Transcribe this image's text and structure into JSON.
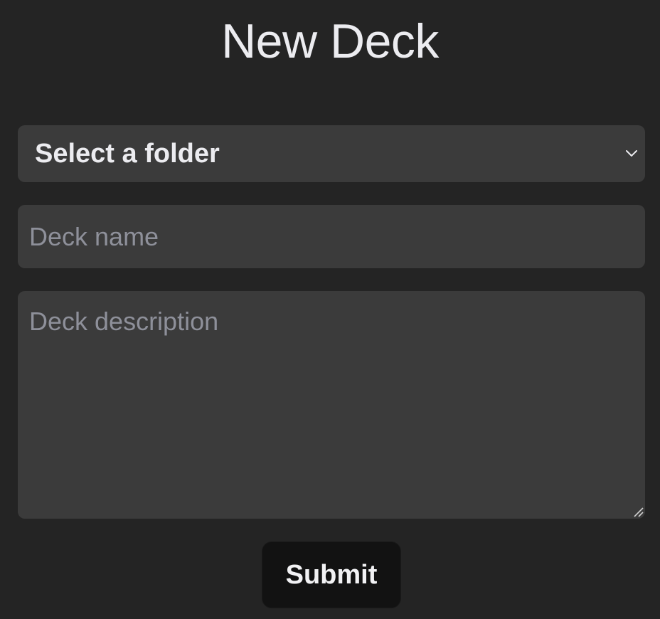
{
  "page": {
    "title": "New Deck"
  },
  "form": {
    "folder_select": {
      "selected_label": "Select a folder",
      "icon": "chevron-down-icon"
    },
    "deck_name": {
      "value": "",
      "placeholder": "Deck name"
    },
    "deck_description": {
      "value": "",
      "placeholder": "Deck description",
      "icon": "resize-handle-icon"
    },
    "submit_label": "Submit"
  },
  "colors": {
    "background": "#242424",
    "field_background": "#3b3b3b",
    "text": "#ececf0",
    "placeholder": "#8e909a",
    "button_background": "#121212"
  }
}
